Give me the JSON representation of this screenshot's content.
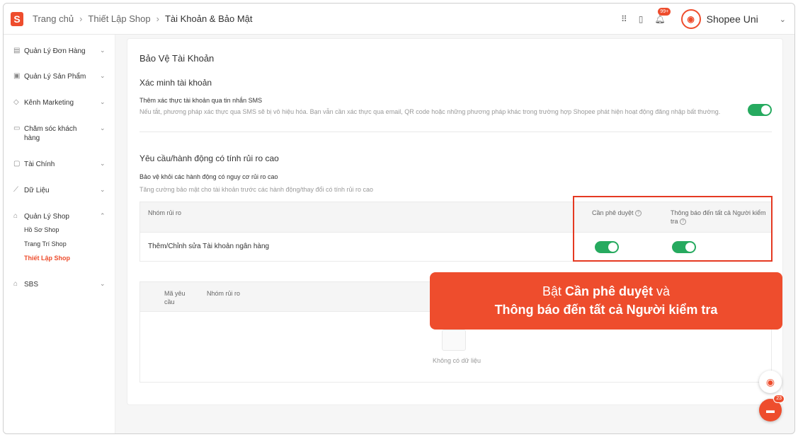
{
  "header": {
    "logo": "S",
    "breadcrumb": [
      "Trang chủ",
      "Thiết Lập Shop",
      "Tài Khoản & Bảo Mật"
    ],
    "notification_badge": "99+",
    "shop_name": "Shopee Uni"
  },
  "sidebar": {
    "items": [
      {
        "label": "Quản Lý Đơn Hàng"
      },
      {
        "label": "Quản Lý Sản Phẩm"
      },
      {
        "label": "Kênh Marketing"
      },
      {
        "label": "Chăm sóc khách hàng"
      },
      {
        "label": "Tài Chính"
      },
      {
        "label": "Dữ Liệu"
      },
      {
        "label": "Quản Lý Shop"
      },
      {
        "label": "SBS"
      }
    ],
    "sub_items": [
      "Hồ Sơ Shop",
      "Trang Trí Shop",
      "Thiết Lập Shop"
    ]
  },
  "main": {
    "title": "Bảo Vệ Tài Khoản",
    "verify": {
      "heading": "Xác minh tài khoản",
      "option_label": "Thêm xác thực tài khoản qua tin nhắn SMS",
      "option_desc": "Nếu tắt, phương pháp xác thực qua SMS sẽ bị vô hiệu hóa. Bạn vẫn cần xác thực qua email, QR code hoặc những phương pháp khác trong trường hợp Shopee phát hiện hoạt động đăng nhập bất thường.",
      "enabled": true
    },
    "risk": {
      "heading": "Yêu cầu/hành động có tính rủi ro cao",
      "option_label": "Bảo vệ khỏi các hành động có nguy cơ rủi ro cao",
      "option_desc": "Tăng cường bảo mật cho tài khoản trước các hành động/thay đổi có tính rủi ro cao",
      "table": {
        "col_group": "Nhóm rủi ro",
        "col_approval": "Cần phê duyệt",
        "col_notify": "Thông báo đến tất cả Người kiểm tra",
        "row_label": "Thêm/Chỉnh sửa Tài khoản ngân hàng",
        "approval_on": true,
        "notify_on": true
      }
    },
    "requests_table": {
      "col_id": "Mã yêu cầu",
      "col_group": "Nhóm rủi ro",
      "empty_text": "Không có dữ liệu"
    }
  },
  "callout": {
    "line1_pre": "Bật ",
    "line1_bold": "Cần phê duyệt",
    "line1_post": " và",
    "line2": "Thông báo đến tất cả Người kiểm tra"
  },
  "chat_count": "23",
  "colors": {
    "accent": "#ee4d2d",
    "toggle_on": "#26aa5f"
  }
}
